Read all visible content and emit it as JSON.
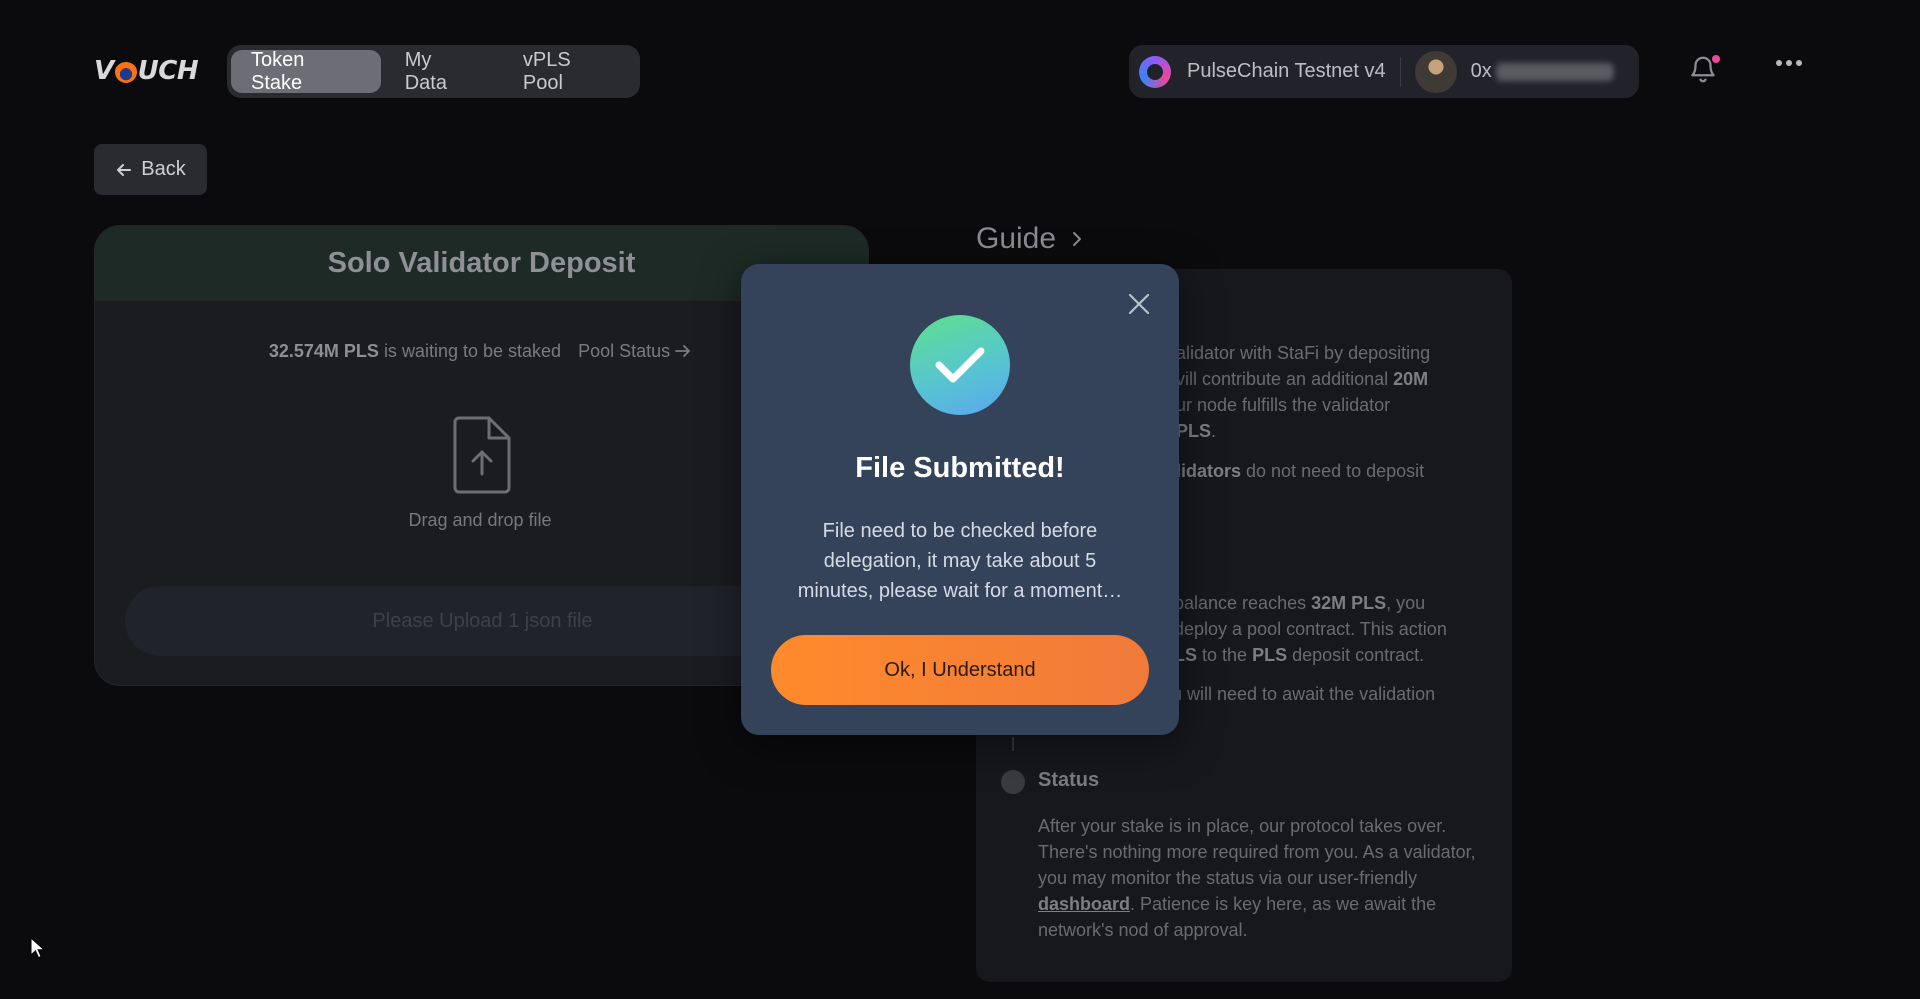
{
  "header": {
    "logo": "VOUCH",
    "nav_tabs": [
      {
        "label": "Token Stake",
        "active": true
      },
      {
        "label": "My Data",
        "active": false
      },
      {
        "label": "vPLS Pool",
        "active": false
      }
    ],
    "network_name": "PulseChain Testnet v4",
    "address_prefix": "0x"
  },
  "back": {
    "label": "Back"
  },
  "deposit": {
    "title": "Solo Validator Deposit",
    "amount": "32.574M PLS",
    "waiting_text": "is waiting to be staked",
    "pool_status": "Pool Status",
    "drag_label": "Drag and drop file",
    "upload_label": "Please Upload 1 json file"
  },
  "guide": {
    "title": "Guide",
    "para1": [
      {
        "text": "alidator with StaFi by depositing"
      },
      {
        "text": "vill contribute an additional "
      },
      {
        "text": "20M"
      },
      {
        "text": "ur node fulfills the validator"
      },
      {
        "text": "PLS"
      }
    ],
    "para2_bold": "lidators",
    "para2_rest": " do not need to deposit",
    "para3": {
      "a": "balance reaches ",
      "b": "32M PLS",
      "c": ", you",
      "line2": "deploy a pool contract. This action",
      "line3a": "LS",
      "line3b": " to the ",
      "line3c": "PLS",
      "line3d": " deposit contract."
    },
    "para4a": "u will need to await the validation",
    "status_title": "Status",
    "status_body_1": "After your stake is in place, our protocol takes over. There's nothing more required from you. As a validator, you may monitor the status via our user-friendly ",
    "status_link": "dashboard",
    "status_body_2": ". Patience is key here, as we await the network's nod of approval."
  },
  "modal": {
    "title": "File Submitted!",
    "message": "File need to be checked before delegation, it may take about 5 minutes, please wait for a moment…",
    "button": "Ok, I Understand"
  },
  "colors": {
    "accent_orange": "#ff8a2b",
    "modal_bg": "#34435a",
    "success_green": "#5ee08b"
  }
}
